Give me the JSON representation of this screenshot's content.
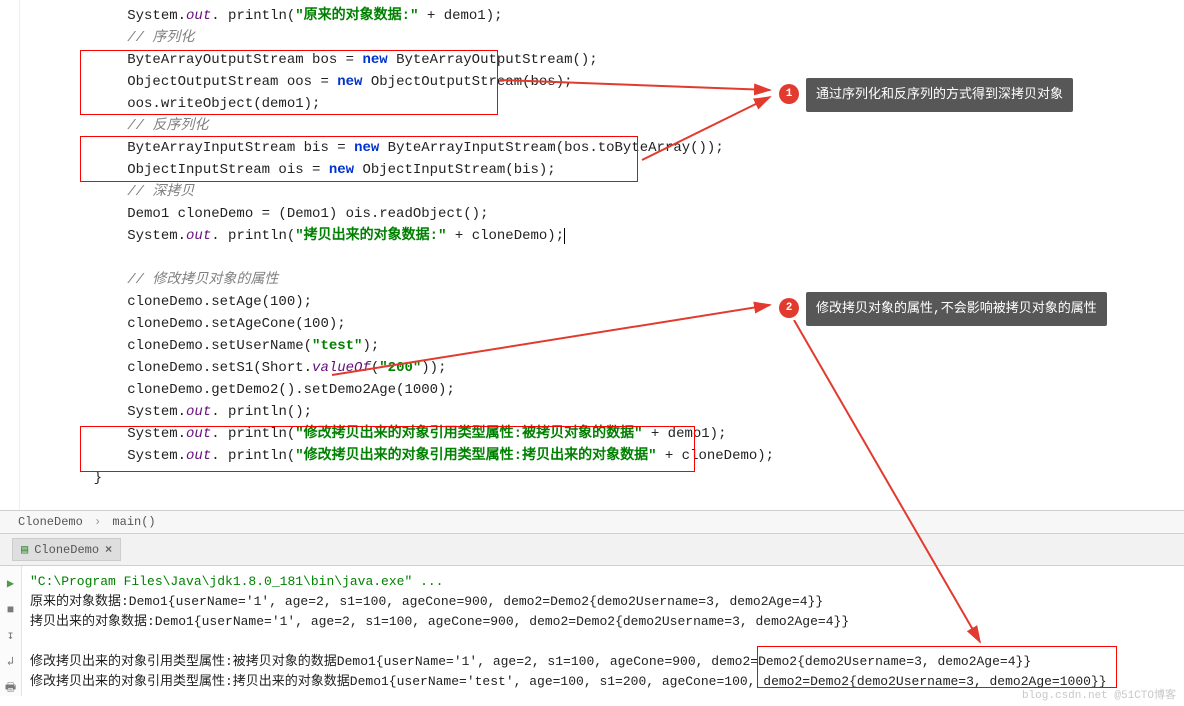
{
  "code": {
    "l1_pre": "        System.",
    "l1_out": "out",
    "l1_mid": ". println(",
    "l1_str": "\"原来的对象数据:\"",
    "l1_post": " + demo1);",
    "l2_comment": "        // 序列化",
    "l3a": "        ByteArrayOutputStream bos = ",
    "l3new": "new",
    "l3b": " ByteArrayOutputStream();",
    "l4a": "        ObjectOutputStream oos = ",
    "l4b": " ObjectOutputStream(bos);",
    "l5": "        oos.writeObject(demo1);",
    "l6_comment": "        // 反序列化",
    "l7a": "        ByteArrayInputStream bis = ",
    "l7b": " ByteArrayInputStream(bos.toByteArray());",
    "l8a": "        ObjectInputStream ois = ",
    "l8b": " ObjectInputStream(bis);",
    "l9_comment": "        // 深拷贝",
    "l10": "        Demo1 cloneDemo = (Demo1) ois.readObject();",
    "l11_pre": "        System.",
    "l11_out": "out",
    "l11_mid": ". println(",
    "l11_str": "\"拷贝出来的对象数据:\"",
    "l11_post": " + cloneDemo);",
    "blank": "",
    "l12_comment": "        // 修改拷贝对象的属性",
    "l13": "        cloneDemo.setAge(100);",
    "l14": "        cloneDemo.setAgeCone(100);",
    "l15a": "        cloneDemo.setUserName(",
    "l15str": "\"test\"",
    "l15b": ");",
    "l16a": "        cloneDemo.setS1(Short.",
    "l16val": "valueOf",
    "l16mid": "(",
    "l16str": "\"200\"",
    "l16b": "));",
    "l17": "        cloneDemo.getDemo2().setDemo2Age(1000);",
    "l18_pre": "        System.",
    "l18_out": "out",
    "l18_post": ". println();",
    "l19_pre": "        System.",
    "l19_out": "out",
    "l19_mid": ". println(",
    "l19_str": "\"修改拷贝出来的对象引用类型属性:被拷贝对象的数据\"",
    "l19_post": " + demo1);",
    "l20_pre": "        System.",
    "l20_out": "out",
    "l20_mid": ". println(",
    "l20_str": "\"修改拷贝出来的对象引用类型属性:拷贝出来的对象数据\"",
    "l20_post": " + cloneDemo);",
    "brace": "    }"
  },
  "breadcrumb": {
    "class": "CloneDemo",
    "method": "main()"
  },
  "run": {
    "tab": "CloneDemo"
  },
  "console": {
    "cmd": "\"C:\\Program Files\\Java\\jdk1.8.0_181\\bin\\java.exe\" ...",
    "out1": "原来的对象数据:Demo1{userName='1', age=2, s1=100, ageCone=900, demo2=Demo2{demo2Username=3, demo2Age=4}}",
    "out2": "拷贝出来的对象数据:Demo1{userName='1', age=2, s1=100, ageCone=900, demo2=Demo2{demo2Username=3, demo2Age=4}}",
    "out3": "修改拷贝出来的对象引用类型属性:被拷贝对象的数据Demo1{userName='1', age=2, s1=100, ageCone=900, demo2=Demo2{demo2Username=3, demo2Age=4}}",
    "out4": "修改拷贝出来的对象引用类型属性:拷贝出来的对象数据Demo1{userName='test', age=100, s1=200, ageCone=100, demo2=Demo2{demo2Username=3, demo2Age=1000}}"
  },
  "annotations": {
    "a1_num": "1",
    "a1_text": "通过序列化和反序列的方式得到深拷贝对象",
    "a2_num": "2",
    "a2_text": "修改拷贝对象的属性,不会影响被拷贝对象的属性"
  },
  "watermark": "blog.csdn.net @51CTO博客"
}
